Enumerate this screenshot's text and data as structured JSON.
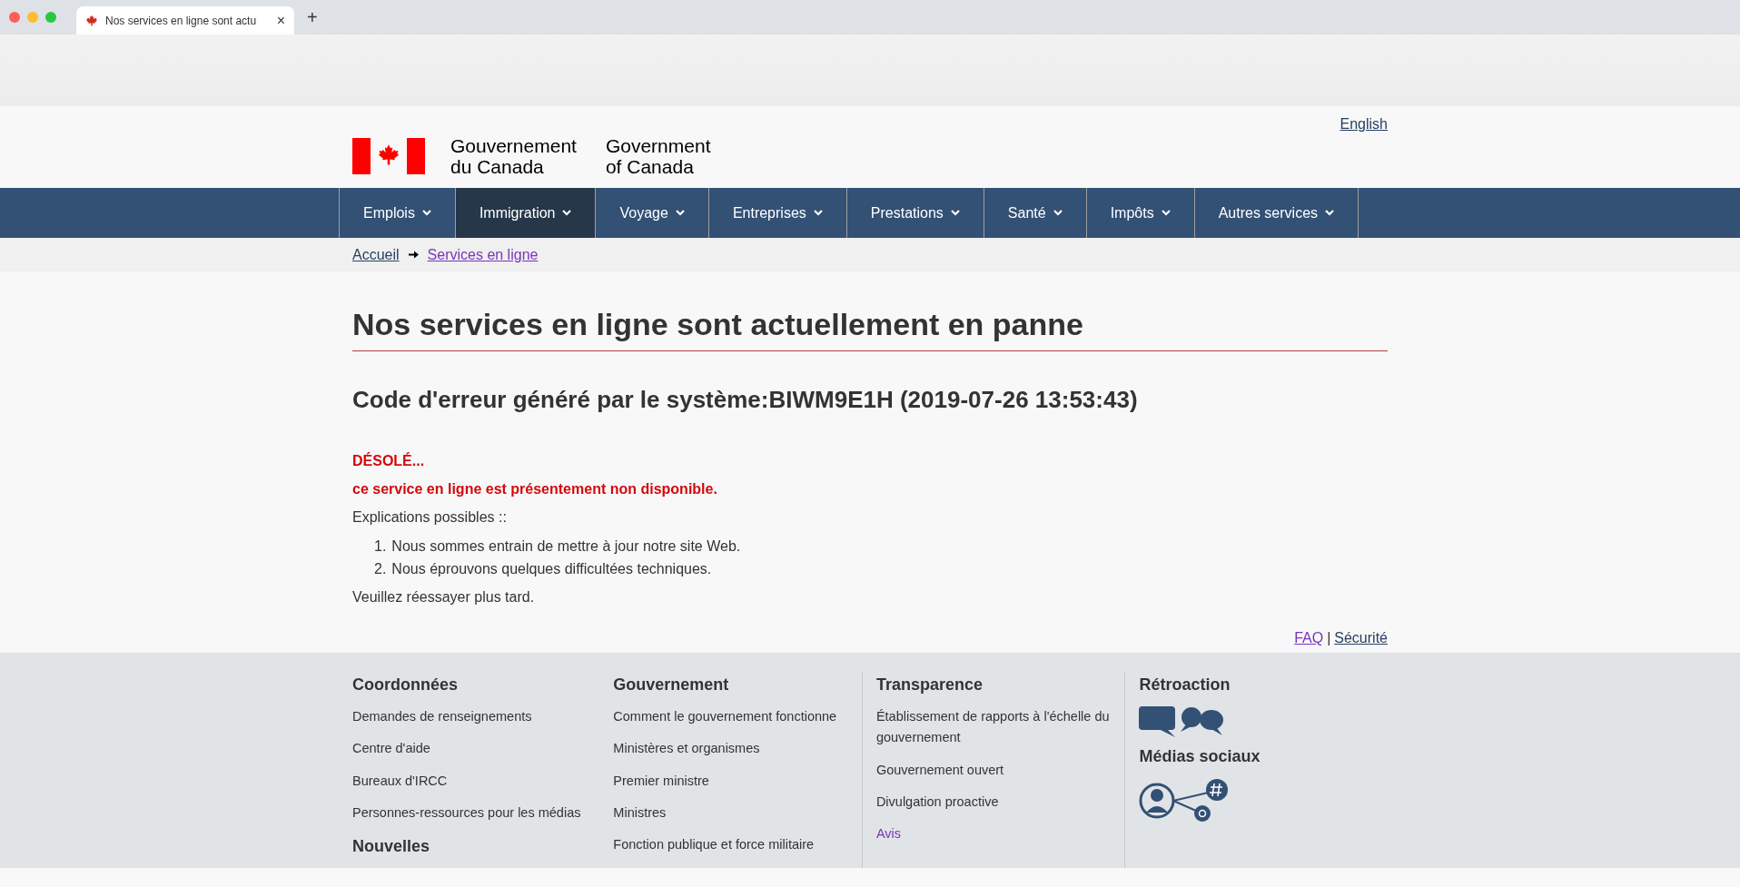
{
  "browser": {
    "tab_title": "Nos services en ligne sont actu",
    "tab_close": "×",
    "new_tab": "+"
  },
  "header": {
    "language_link": "English",
    "brand_fr": [
      "Gouvernement",
      "du Canada"
    ],
    "brand_en": [
      "Government",
      "of Canada"
    ]
  },
  "nav": [
    {
      "label": "Emplois",
      "selected": false
    },
    {
      "label": "Immigration",
      "selected": true
    },
    {
      "label": "Voyage",
      "selected": false
    },
    {
      "label": "Entreprises",
      "selected": false
    },
    {
      "label": "Prestations",
      "selected": false
    },
    {
      "label": "Santé",
      "selected": false
    },
    {
      "label": "Impôts",
      "selected": false
    },
    {
      "label": "Autres services",
      "selected": false
    }
  ],
  "breadcrumb": [
    {
      "label": "Accueil",
      "visited": false
    },
    {
      "label": "Services en ligne",
      "visited": true
    }
  ],
  "main": {
    "title": "Nos services en ligne sont actuellement en panne",
    "error_code": "Code d'erreur généré par le système:BIWM9E1H (2019-07-26 13:53:43)",
    "sorry": "DÉSOLÉ...",
    "unavailable": "ce service en ligne est présentement non disponible.",
    "explanations_label": "Explications possibles ::",
    "explanations": [
      {
        "marker": "1.",
        "text": "Nous sommes entrain de mettre à jour notre site Web."
      },
      {
        "marker": "2.",
        "text": "Nous éprouvons quelques difficultées techniques."
      }
    ],
    "retry": "Veuillez réessayer plus tard."
  },
  "page_links": [
    {
      "label": "FAQ",
      "visited": true
    },
    {
      "label": "Sécurité",
      "visited": false
    }
  ],
  "page_links_separator": "|",
  "footer": [
    {
      "sections": [
        {
          "heading": "Coordonnées",
          "links": [
            {
              "label": "Demandes de renseignements",
              "visited": false
            },
            {
              "label": "Centre d'aide",
              "visited": false
            },
            {
              "label": "Bureaux d'IRCC",
              "visited": false
            },
            {
              "label": "Personnes-ressources pour les médias",
              "visited": false
            }
          ]
        },
        {
          "heading": "Nouvelles"
        }
      ]
    },
    {
      "sections": [
        {
          "heading": "Gouvernement",
          "links": [
            {
              "label": "Comment le gouvernement fonctionne",
              "visited": false
            },
            {
              "label": "Ministères et organismes",
              "visited": false
            },
            {
              "label": "Premier ministre",
              "visited": false
            },
            {
              "label": "Ministres",
              "visited": false
            },
            {
              "label": "Fonction publique et force militaire",
              "visited": false
            }
          ]
        }
      ]
    },
    {
      "sections": [
        {
          "heading": "Transparence",
          "links": [
            {
              "label": "Établissement de rapports à l'échelle du gouvernement",
              "visited": false
            },
            {
              "label": "Gouvernement ouvert",
              "visited": false
            },
            {
              "label": "Divulgation proactive",
              "visited": false
            },
            {
              "label": "Avis",
              "visited": true
            }
          ]
        }
      ]
    },
    {
      "sections": [
        {
          "heading": "Rétroaction",
          "kind": "chat"
        },
        {
          "heading": "Médias sociaux",
          "kind": "social"
        }
      ]
    }
  ]
}
